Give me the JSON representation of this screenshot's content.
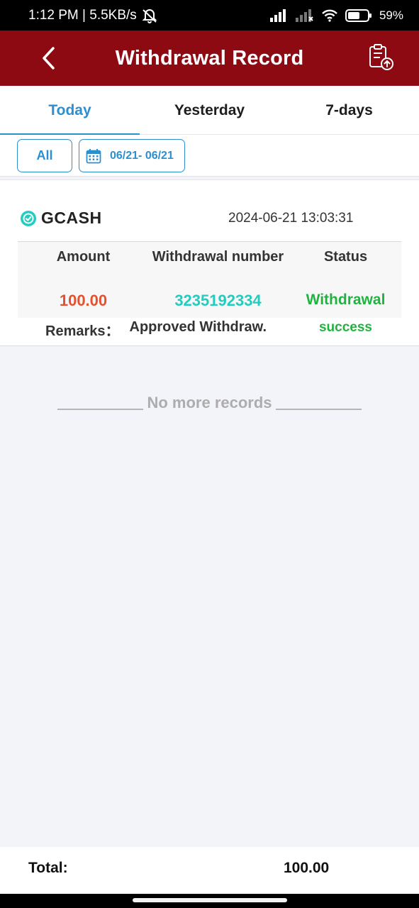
{
  "status_bar": {
    "time_speed": "1:12 PM | 5.5KB/s",
    "battery_pct": "59%"
  },
  "header": {
    "title": "Withdrawal Record",
    "back_icon": "chevron-left-icon",
    "record_icon": "clipboard-upload-icon"
  },
  "tabs": [
    {
      "label": "Today",
      "active": true
    },
    {
      "label": "Yesterday",
      "active": false
    },
    {
      "label": "7-days",
      "active": false
    }
  ],
  "filters": {
    "all_label": "All",
    "date_range": "06/21- 06/21",
    "date_icon": "calendar-icon"
  },
  "record": {
    "method": "GCASH",
    "method_icon": "gcash-check-icon",
    "timestamp": "2024-06-21 13:03:31",
    "headers": {
      "amount": "Amount",
      "number": "Withdrawal number",
      "status": "Status"
    },
    "amount": "100.00",
    "withdrawal_number": "3235192334",
    "status_line1": "Withdrawal",
    "status_line2": "success",
    "remarks_label": "Remarks：",
    "remarks_value": "Approved Withdraw."
  },
  "no_more_text": "No more records",
  "footer": {
    "total_label": "Total:",
    "total_value": "100.00"
  },
  "colors": {
    "header_bg": "#8d0a12",
    "accent": "#2c8fd0",
    "amount": "#e4512f",
    "number": "#22cdc0",
    "success": "#21b33f"
  }
}
